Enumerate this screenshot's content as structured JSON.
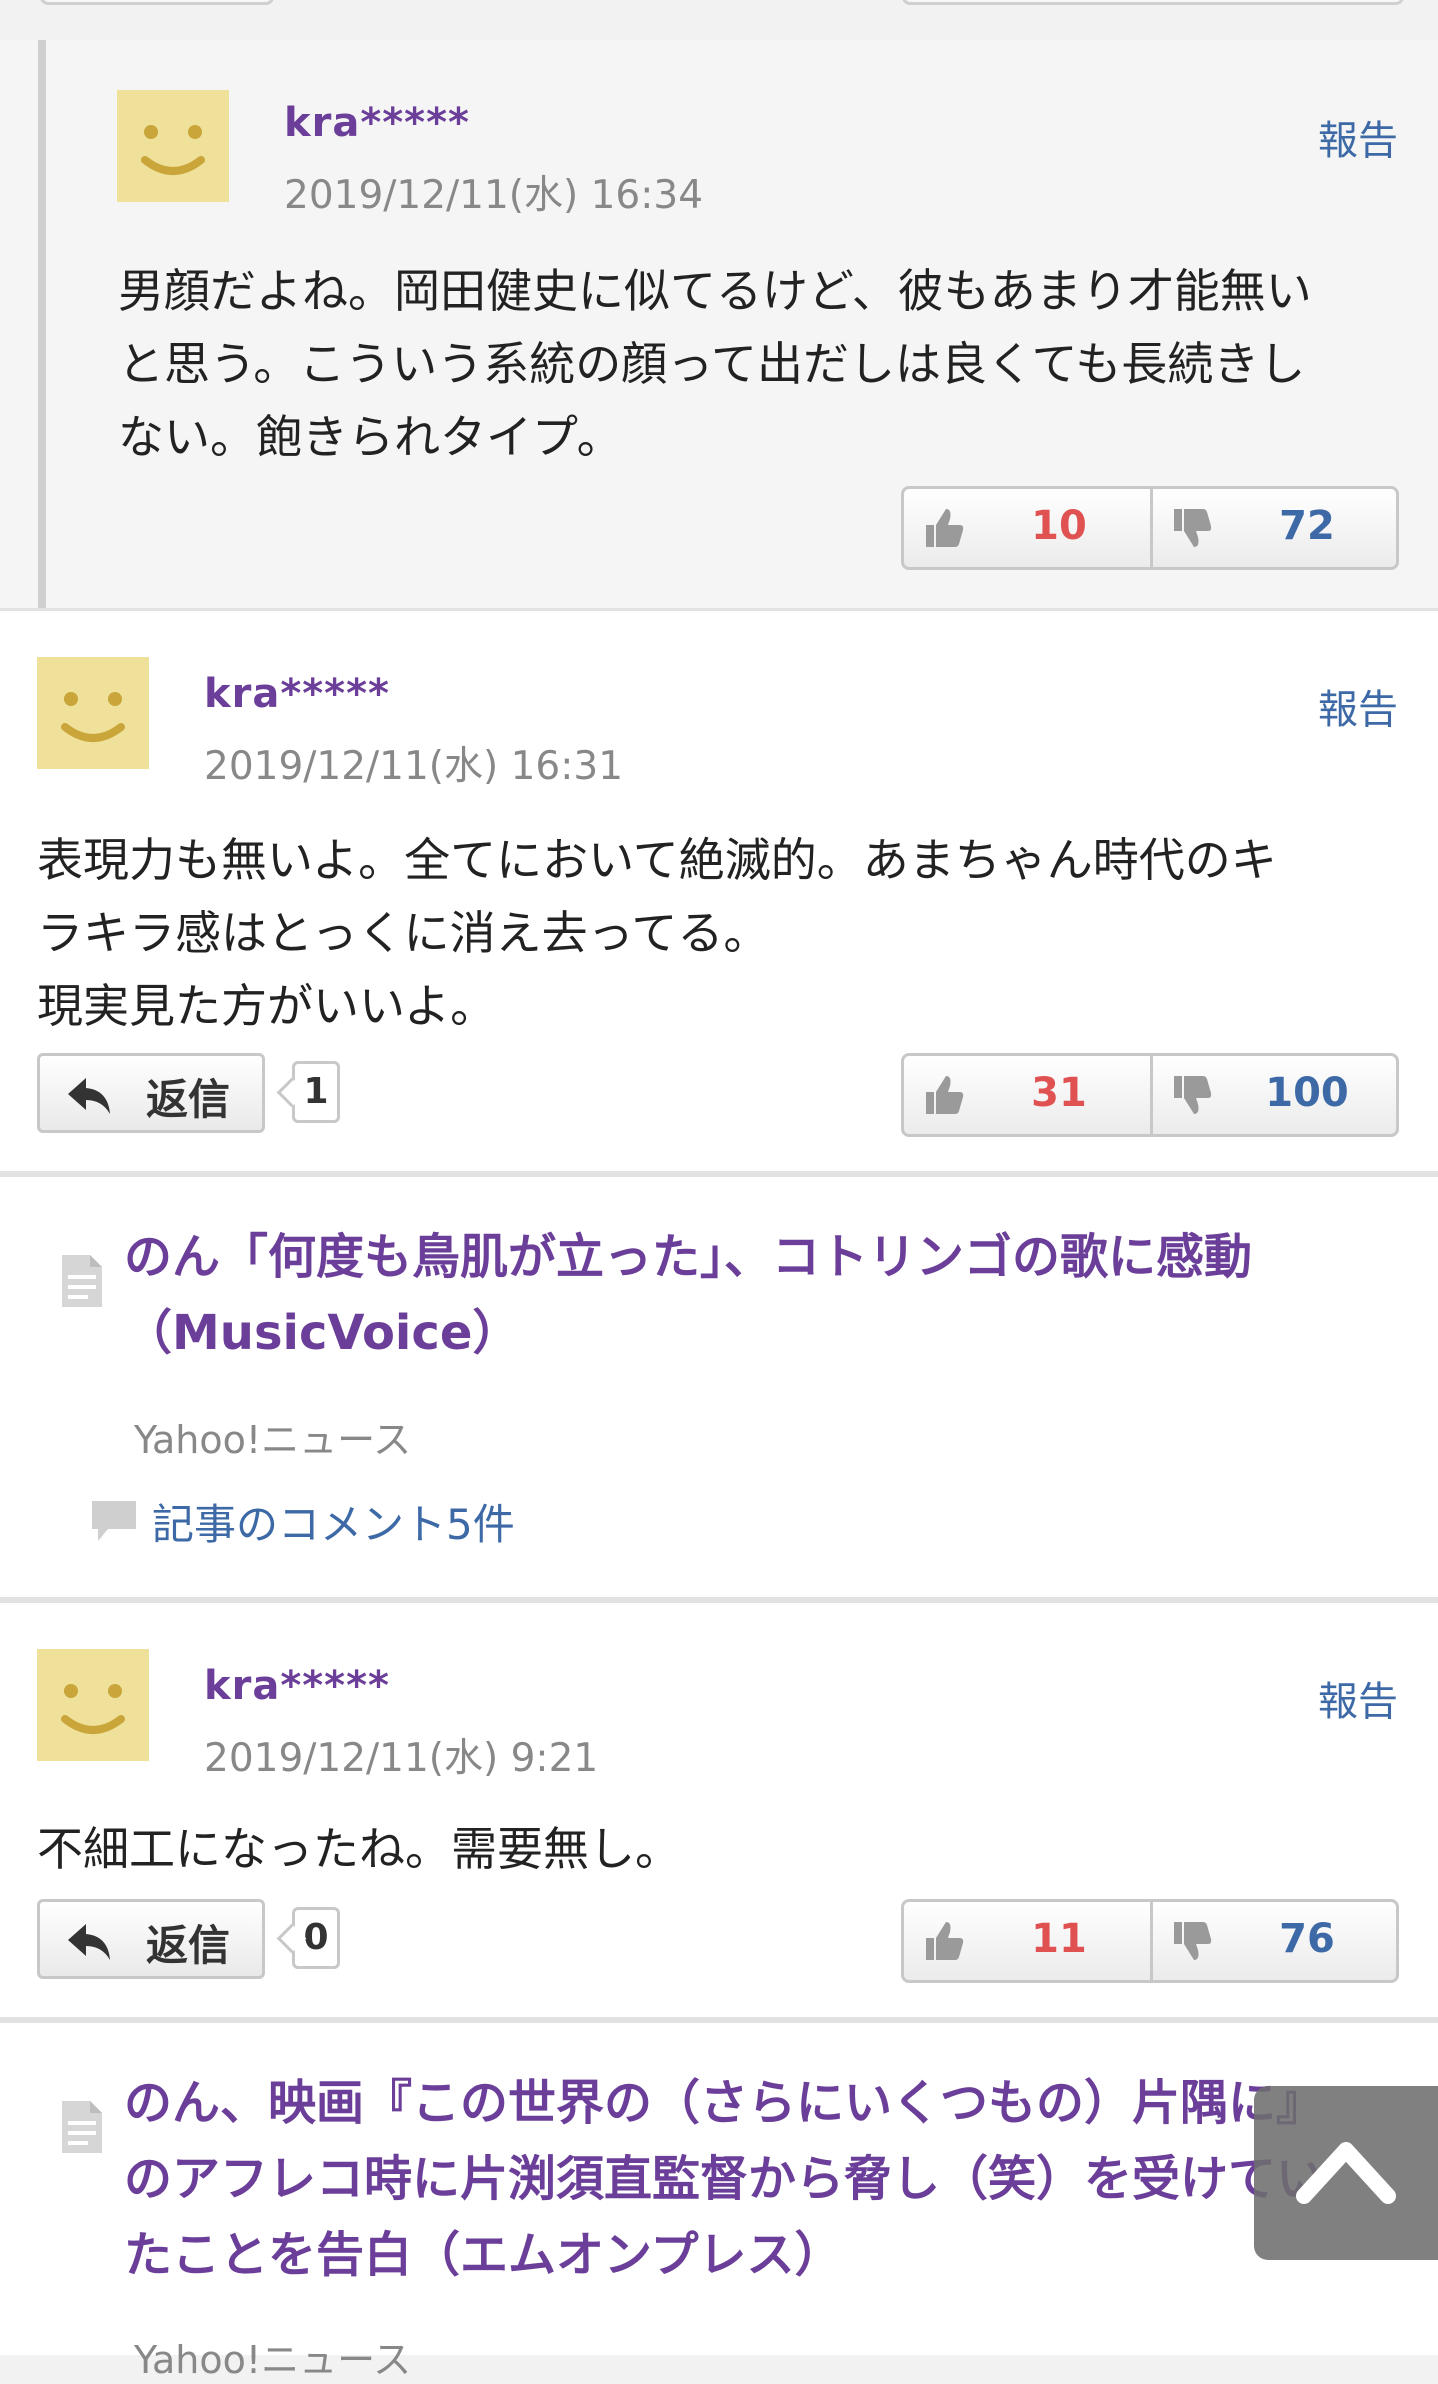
{
  "comments": [
    {
      "username": "kra*****",
      "timestamp": "2019/12/11(水) 16:34",
      "report_label": "報告",
      "body": "男顔だよね。岡田健史に似てるけど、彼もあまり才能無い\nと思う。こういう系統の顔って出だしは良くても長続きし\nない。飽きられタイプ。",
      "likes": "10",
      "dislikes": "72"
    },
    {
      "username": "kra*****",
      "timestamp": "2019/12/11(水) 16:31",
      "report_label": "報告",
      "body": "表現力も無いよ。全てにおいて絶滅的。あまちゃん時代のキ\nラキラ感はとっくに消え去ってる。\n現実見た方がいいよ。",
      "reply_label": "返信",
      "reply_count": "1",
      "likes": "31",
      "dislikes": "100"
    },
    {
      "username": "kra*****",
      "timestamp": "2019/12/11(水) 9:21",
      "report_label": "報告",
      "body": "不細工になったね。需要無し。",
      "reply_label": "返信",
      "reply_count": "0",
      "likes": "11",
      "dislikes": "76"
    }
  ],
  "articles": [
    {
      "title": "のん「何度も鳥肌が立った」、コトリンゴの歌に感動\n（MusicVoice）",
      "source": "Yahoo!ニュース",
      "comment_link": "記事のコメント5件"
    },
    {
      "title": "のん、映画『この世界の（さらにいくつもの）片隅に』\nのアフレコ時に片渕須直監督から脅し（笑）を受けてい\nたことを告白（エムオンプレス）",
      "source": "Yahoo!ニュース"
    }
  ]
}
